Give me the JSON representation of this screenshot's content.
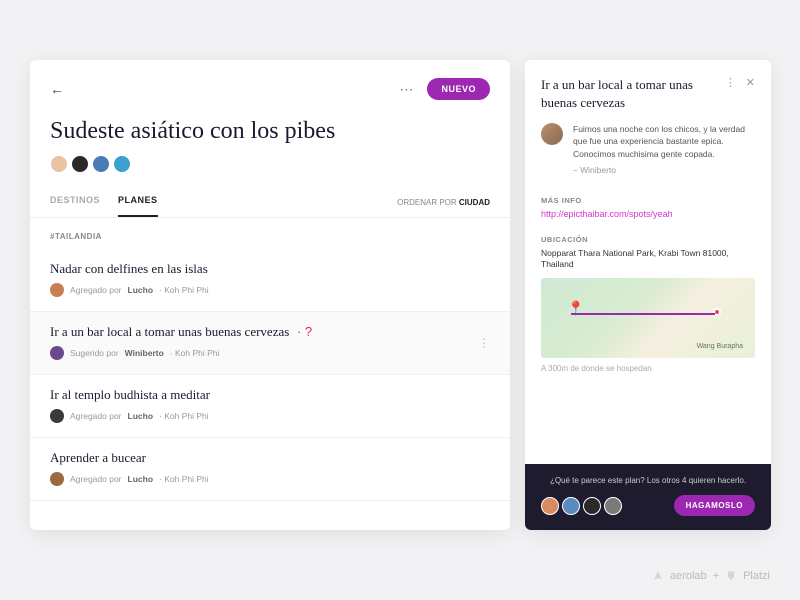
{
  "header": {
    "new_button": "NUEVO",
    "title": "Sudeste asiático con los pibes"
  },
  "avatars": [
    "#e8c4a0",
    "#2a2a2a",
    "#4a7ab8",
    "#3aa0d0"
  ],
  "tabs": {
    "destinos": "DESTINOS",
    "planes": "PLANES",
    "sort_prefix": "ORDENAR POR",
    "sort_value": "CIUDAD"
  },
  "tag": "#TAILANDIA",
  "plans": [
    {
      "title": "Nadar con delfines en las islas",
      "added_prefix": "Agregado por",
      "author": "Lucho",
      "location": "Koh Phi Phi",
      "suggested": false,
      "selected": false,
      "avatar": "#c97f50"
    },
    {
      "title": "Ir a un bar local a tomar unas buenas cervezas",
      "added_prefix": "Sugerido por",
      "author": "Winiberto",
      "location": "Koh Phi Phi",
      "suggested": true,
      "selected": true,
      "avatar": "#6a4a8a"
    },
    {
      "title": "Ir al templo budhista a meditar",
      "added_prefix": "Agregado por",
      "author": "Lucho",
      "location": "Koh Phi Phi",
      "suggested": false,
      "selected": false,
      "avatar": "#3a3a3a"
    },
    {
      "title": "Aprender a bucear",
      "added_prefix": "Agregado por",
      "author": "Lucho",
      "location": "Koh Phi Phi",
      "suggested": false,
      "selected": false,
      "avatar": "#9a6a40"
    }
  ],
  "panel": {
    "title": "Ir a un bar local a tomar unas buenas cervezas",
    "comment": "Fuimos una noche con los chicos, y la verdad que fue una experiencia bastante epica. Conocimos muchisima gente copada.",
    "comment_author": "– Winiberto",
    "more_info_label": "MÁS INFO",
    "info_link": "http://epicthaibar.com/spots/yeah",
    "location_label": "UBICACIÓN",
    "address": "Nopparat Thara National Park, Krabi Town 81000, Thailand",
    "map_area": "Wang Burapha",
    "distance": "A 300m de donde se hospedan"
  },
  "footer": {
    "question": "¿Qué te parece este plan? Los otros 4 quieren hacerlo.",
    "button": "HAGAMOSLO",
    "avatars": [
      "#d88a60",
      "#5a8ac0",
      "#2a2a2a",
      "#7a7a7a"
    ]
  },
  "credits": {
    "brand1": "aerolab",
    "plus": "+",
    "brand2": "Platzi"
  }
}
